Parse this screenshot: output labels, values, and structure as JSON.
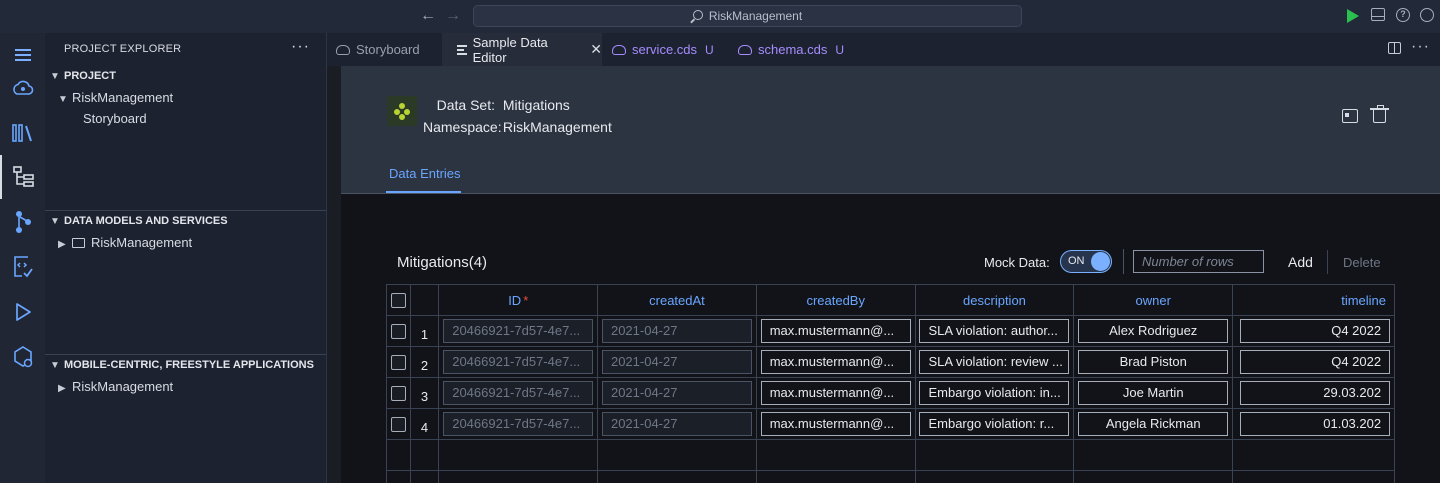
{
  "titlebar": {
    "search_text": "RiskManagement"
  },
  "activity_bar": {
    "icons": [
      "menu-icon",
      "cloud-icon",
      "library-icon",
      "explorer-tree-icon",
      "graph-icon",
      "code-check-icon",
      "run-icon",
      "deploy-icon"
    ]
  },
  "sidebar": {
    "header": "PROJECT EXPLORER",
    "more": "···",
    "sections": [
      {
        "title": "PROJECT",
        "items": [
          {
            "label": "RiskManagement"
          },
          {
            "label": "Storyboard"
          }
        ]
      },
      {
        "title": "DATA MODELS AND SERVICES",
        "items": [
          {
            "label": "RiskManagement"
          }
        ]
      },
      {
        "title": "MOBILE-CENTRIC, FREESTYLE APPLICATIONS",
        "items": [
          {
            "label": "RiskManagement"
          }
        ]
      }
    ]
  },
  "tabs": [
    {
      "label": "Storyboard"
    },
    {
      "label": "Sample Data Editor",
      "close": "✕"
    },
    {
      "label": "service.cds",
      "modified": "U"
    },
    {
      "label": "schema.cds",
      "modified": "U"
    }
  ],
  "editor": {
    "data_set_label": "Data Set:",
    "data_set_value": "Mitigations",
    "namespace_label": "Namespace:",
    "namespace_value": "RiskManagement",
    "active_tab": "Data Entries"
  },
  "toolbar": {
    "title": "Mitigations(4)",
    "mock_label": "Mock Data:",
    "toggle_text": "ON",
    "rows_placeholder": "Number of rows",
    "add_label": "Add",
    "delete_label": "Delete"
  },
  "table": {
    "columns": [
      "ID",
      "createdAt",
      "createdBy",
      "description",
      "owner",
      "timeline"
    ],
    "required_mark": "*",
    "rows": [
      {
        "num": "1",
        "id": "20466921-7d57-4e7...",
        "createdAt": "2021-04-27",
        "createdBy": "max.mustermann@...",
        "description": "SLA violation: author...",
        "owner": "Alex Rodriguez",
        "timeline": "Q4 2022"
      },
      {
        "num": "2",
        "id": "20466921-7d57-4e7...",
        "createdAt": "2021-04-27",
        "createdBy": "max.mustermann@...",
        "description": "SLA violation: review ...",
        "owner": "Brad Piston",
        "timeline": "Q4 2022"
      },
      {
        "num": "3",
        "id": "20466921-7d57-4e7...",
        "createdAt": "2021-04-27",
        "createdBy": "max.mustermann@...",
        "description": "Embargo violation: in...",
        "owner": "Joe Martin",
        "timeline": "29.03.202"
      },
      {
        "num": "4",
        "id": "20466921-7d57-4e7...",
        "createdAt": "2021-04-27",
        "createdBy": "max.mustermann@...",
        "description": "Embargo violation: r...",
        "owner": "Angela Rickman",
        "timeline": "01.03.202"
      }
    ]
  }
}
